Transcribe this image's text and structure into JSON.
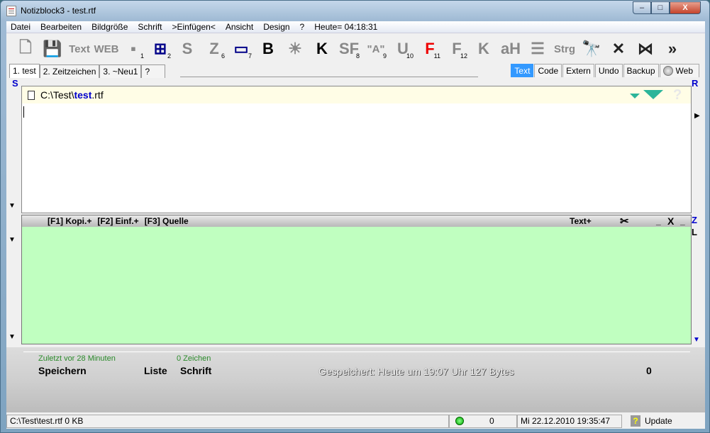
{
  "window": {
    "title": "Notizblock3  -  test.rtf",
    "min": "–",
    "max": "□",
    "close": "X"
  },
  "menu": [
    "Datei",
    "Bearbeiten",
    "Bildgröße",
    "Schrift",
    ">Einfügen<",
    "Ansicht",
    "Design",
    "?",
    "Heute= 04:18:31"
  ],
  "toolbar": [
    {
      "name": "new-document-icon",
      "glyph": "🗋",
      "sub": ""
    },
    {
      "name": "save-icon",
      "glyph": "💾",
      "sub": ""
    },
    {
      "name": "text-icon",
      "glyph": "Text",
      "sub": ""
    },
    {
      "name": "web-icon",
      "glyph": "WEB",
      "sub": ""
    },
    {
      "name": "insert-1-icon",
      "glyph": "▪",
      "sub": "1"
    },
    {
      "name": "insert-2-icon",
      "glyph": "⊞",
      "sub": "2"
    },
    {
      "name": "s-icon",
      "glyph": "S",
      "sub": ""
    },
    {
      "name": "z-icon",
      "glyph": "Z",
      "sub": "6"
    },
    {
      "name": "window-icon",
      "glyph": "▭",
      "sub": "7"
    },
    {
      "name": "bold-icon",
      "glyph": "B",
      "sub": ""
    },
    {
      "name": "lamp-icon",
      "glyph": "☀",
      "sub": ""
    },
    {
      "name": "k-icon",
      "glyph": "K",
      "sub": ""
    },
    {
      "name": "sf-icon",
      "glyph": "SF",
      "sub": "8"
    },
    {
      "name": "quote-icon",
      "glyph": "\"A\"",
      "sub": "9"
    },
    {
      "name": "underline-icon",
      "glyph": "U",
      "sub": "10"
    },
    {
      "name": "font-red-icon",
      "glyph": "F",
      "sub": "11"
    },
    {
      "name": "font-gray-icon",
      "glyph": "F",
      "sub": "12"
    },
    {
      "name": "italic-icon",
      "glyph": "K",
      "sub": ""
    },
    {
      "name": "ah-icon",
      "glyph": "aH",
      "sub": ""
    },
    {
      "name": "align-icon",
      "glyph": "☰",
      "sub": ""
    },
    {
      "name": "strg-icon",
      "glyph": "Strg",
      "sub": ""
    },
    {
      "name": "binoculars-icon",
      "glyph": "🔭",
      "sub": ""
    },
    {
      "name": "cut-icon",
      "glyph": "✕",
      "sub": ""
    },
    {
      "name": "merge-icon",
      "glyph": "⋈",
      "sub": ""
    },
    {
      "name": "more-icon",
      "glyph": "»",
      "sub": ""
    }
  ],
  "tabs": [
    "1. test",
    "2. Zeitzeichen",
    "3. ~Neu1",
    "?"
  ],
  "right_tabs": [
    "Text",
    "Code",
    "Extern",
    "Undo",
    "Backup",
    "Web"
  ],
  "editor": {
    "path_prefix": "C:\\Test\\",
    "path_name": "test",
    ".ext": "",
    "path_ext": ".rtf",
    "help": "?"
  },
  "side": {
    "s": "S",
    "r": "R",
    "z": "Z",
    "l": "L"
  },
  "clip": {
    "f1": "[F1] Kopi.+",
    "f2": "[F2] Einf.+",
    "f3": "[F3] Quelle",
    "textplus": "Text+",
    "scissors": "✂",
    "min": "_",
    "close": "X",
    "min2": "_"
  },
  "status": {
    "last": "Zuletzt vor 28 Minuten",
    "chars": "0 Zeichen",
    "save": "Speichern",
    "list": "Liste",
    "font": "Schrift",
    "saved": "Gespeichert: Heute um 19:07 Uhr  127 Bytes",
    "count": "0"
  },
  "statusbar": {
    "file": "C:\\Test\\test.rtf  0 KB",
    "num": "0",
    "datetime": "Mi 22.12.2010 19:35:47",
    "update": "Update",
    "qm": "?"
  },
  "colors": {
    "active_tab": "#3399ff",
    "clip_bg": "#c0ffc0",
    "editor_header": "#fffde6",
    "accent_blue": "#0000cc"
  }
}
